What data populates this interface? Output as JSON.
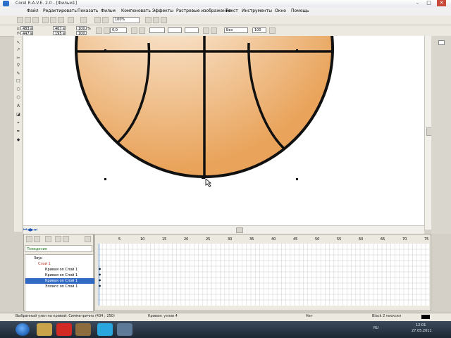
{
  "window": {
    "title": "Corel R.A.V.E. 2.0 - [Фильм1]",
    "min_label": "–",
    "max_label": "□",
    "close_label": "✕"
  },
  "menu": [
    "Файл",
    "Редактировать",
    "Показать",
    "Фильм",
    "Компоновать",
    "Эффекты",
    "Растровые изображения",
    "Текст",
    "Инструменты",
    "Окно",
    "Помощь"
  ],
  "toolbar": {
    "zoom_value": "100%"
  },
  "propbar": {
    "x_label": "x:",
    "x_value": "483 в",
    "y_label": "y:",
    "y_value": "447 в",
    "w_value": "467 в",
    "h_value": "195 в",
    "scale_w": "100,0",
    "scale_h": "100,0",
    "pct": "%",
    "angle_value": "0,0",
    "outline_value": "Без",
    "num_value": "100"
  },
  "canvas": {
    "ball_fill_light": "#fdf8f0",
    "ball_fill_dark": "#e9a35a",
    "stroke": "#111111"
  },
  "layers_panel": {
    "tab_title": "Поведение",
    "rows": [
      {
        "label": "Звук"
      },
      {
        "label": "Слой 1"
      },
      {
        "label": "Кривая on Слой 1"
      },
      {
        "label": "Кривая on Слой 1"
      },
      {
        "label": "Кривая on Слой 1"
      },
      {
        "label": "Эллипс on Слой 1"
      }
    ],
    "selected_index": 4
  },
  "timeline": {
    "frame_numbers": [
      "5",
      "10",
      "15",
      "20",
      "25",
      "30",
      "35",
      "40",
      "45",
      "50",
      "55",
      "60",
      "65",
      "70",
      "75"
    ]
  },
  "status": {
    "left": "Выбранный узел на кривой: Симметрично (434 ; 250)",
    "middle": "Кривая: узлов 4",
    "fill_label": "Нет",
    "outline_label": "Black 2 писксел",
    "colors": {
      "accent": "#316ac5"
    }
  },
  "taskbar": {
    "lang": "RU",
    "time": "12:01",
    "date": "27.05.2011"
  }
}
